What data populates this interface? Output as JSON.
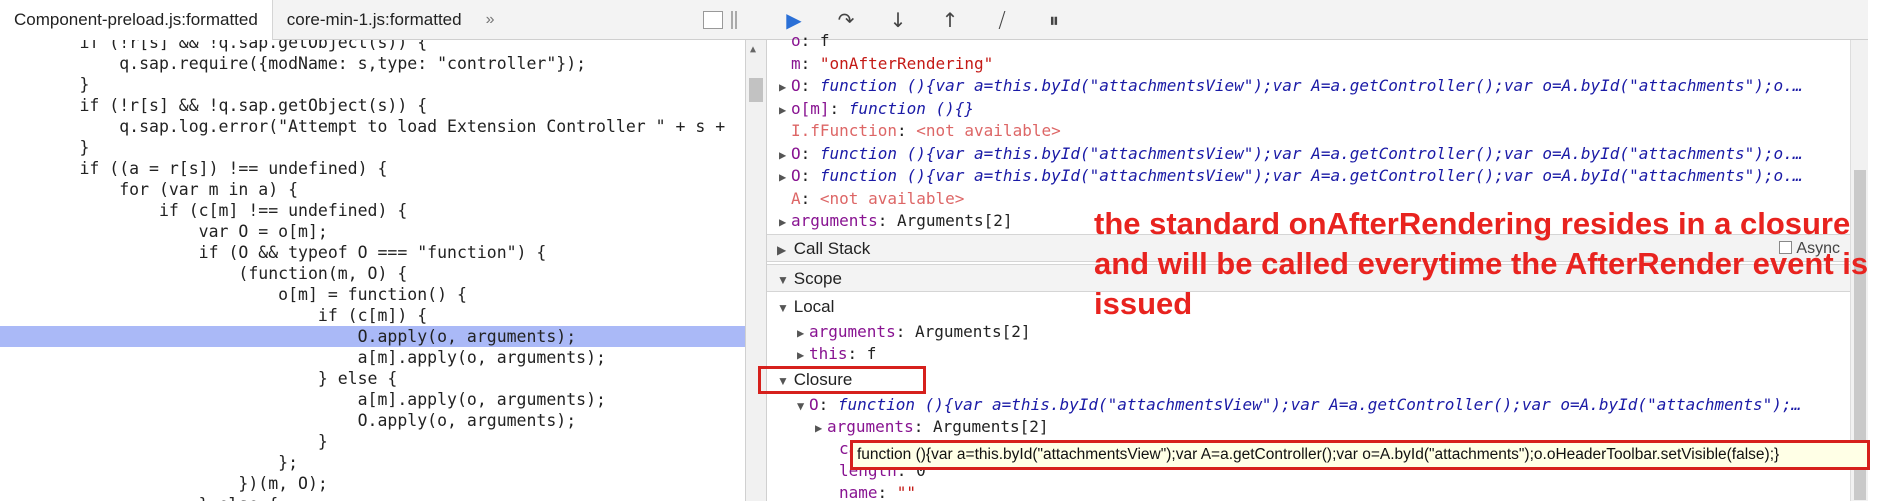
{
  "tabs": {
    "items": [
      "Component-preload.js:formatted",
      "core-min-1.js:formatted"
    ],
    "more": "»"
  },
  "code": [
    {
      "text": "        if (!r[s] && !q.sap.getObject(s)) {",
      "hl": false
    },
    {
      "text": "            q.sap.require({modName: s,type: \"controller\"});",
      "hl": false
    },
    {
      "text": "        }",
      "hl": false
    },
    {
      "text": "        if (!r[s] && !q.sap.getObject(s)) {",
      "hl": false
    },
    {
      "text": "            q.sap.log.error(\"Attempt to load Extension Controller \" + s +",
      "hl": false
    },
    {
      "text": "        }",
      "hl": false
    },
    {
      "text": "        if ((a = r[s]) !== undefined) {",
      "hl": false
    },
    {
      "text": "            for (var m in a) {",
      "hl": false
    },
    {
      "text": "                if (c[m] !== undefined) {",
      "hl": false
    },
    {
      "text": "                    var O = o[m];",
      "hl": false
    },
    {
      "text": "                    if (O && typeof O === \"function\") {",
      "hl": false
    },
    {
      "text": "                        (function(m, O) {",
      "hl": false
    },
    {
      "text": "                            o[m] = function() {",
      "hl": false
    },
    {
      "text": "                                if (c[m]) {",
      "hl": false
    },
    {
      "text": "                                    O.apply(o, arguments);",
      "hl": true
    },
    {
      "text": "                                    a[m].apply(o, arguments);",
      "hl": false
    },
    {
      "text": "                                } else {",
      "hl": false
    },
    {
      "text": "                                    a[m].apply(o, arguments);",
      "hl": false
    },
    {
      "text": "                                    O.apply(o, arguments);",
      "hl": false
    },
    {
      "text": "                                }",
      "hl": false
    },
    {
      "text": "                            };",
      "hl": false
    },
    {
      "text": "                        })(m, O);",
      "hl": false
    },
    {
      "text": "                    } else {",
      "hl": false
    }
  ],
  "debugger": {
    "toolbar": [
      "resume",
      "step-over",
      "step-into",
      "step-out",
      "deactivate-breakpoints",
      "pause-on-exceptions"
    ],
    "watch_rows": [
      {
        "tri": "",
        "key": "o",
        "sep": ": ",
        "val": "f",
        "kind": "plain"
      },
      {
        "tri": "",
        "key": "m",
        "sep": ": ",
        "val": "\"onAfterRendering\"",
        "kind": "str"
      },
      {
        "tri": "▶",
        "key": "O",
        "sep": ": ",
        "val": "function (){var a=this.byId(\"attachmentsView\");var A=a.getController();var o=A.byId(\"attachments\");o.…",
        "kind": "fn"
      },
      {
        "tri": "▶",
        "key": "o[m]",
        "sep": ": ",
        "val": "function (){}",
        "kind": "fn"
      },
      {
        "tri": "",
        "key": "I.fFunction",
        "sep": ": ",
        "val": "<not available>",
        "kind": "na"
      },
      {
        "tri": "▶",
        "key": "O",
        "sep": ": ",
        "val": "function (){var a=this.byId(\"attachmentsView\");var A=a.getController();var o=A.byId(\"attachments\");o.…",
        "kind": "fn"
      },
      {
        "tri": "▶",
        "key": "O",
        "sep": ": ",
        "val": "function (){var a=this.byId(\"attachmentsView\");var A=a.getController();var o=A.byId(\"attachments\");o.…",
        "kind": "fn"
      },
      {
        "tri": "",
        "key": "A",
        "sep": ": ",
        "val": "<not available>",
        "kind": "na"
      },
      {
        "tri": "▶",
        "key": "arguments",
        "sep": ": ",
        "val": "Arguments[2]",
        "kind": "plain"
      }
    ],
    "call_stack": {
      "label": "Call Stack",
      "async": "Async"
    },
    "scope": {
      "label": "Scope"
    },
    "local": {
      "label": "Local",
      "rows": [
        {
          "tri": "▶",
          "key": "arguments",
          "sep": ": ",
          "val": "Arguments[2]",
          "kind": "plain"
        },
        {
          "tri": "▶",
          "key": "this",
          "sep": ": ",
          "val": "f",
          "kind": "plain"
        }
      ]
    },
    "closure": {
      "label": "Closure",
      "rows": [
        {
          "tri": "▼",
          "key": "O",
          "sep": ": ",
          "val": "function (){var a=this.byId(\"attachmentsView\");var A=a.getController();var o=A.byId(\"attachments\");…",
          "kind": "fn"
        },
        {
          "tri": "▶",
          "key": "arguments",
          "sep": ": ",
          "val": "Arguments[2]",
          "kind": "plain"
        },
        {
          "tri": "",
          "key": "ca",
          "sep": "",
          "val": "",
          "kind": "plain"
        },
        {
          "tri": "",
          "key": "length",
          "sep": ": ",
          "val": "0",
          "kind": "plain"
        },
        {
          "tri": "",
          "key": "name",
          "sep": ": ",
          "val": "\"\"",
          "kind": "str"
        }
      ]
    }
  },
  "annotation": "the standard onAfterRendering resides in a closure and will be called everytime the AfterRender event is issued",
  "tooltip": "function (){var a=this.byId(\"attachmentsView\");var A=a.getController();var o=A.byId(\"attachments\");o.oHeaderToolbar.setVisible(false);}"
}
